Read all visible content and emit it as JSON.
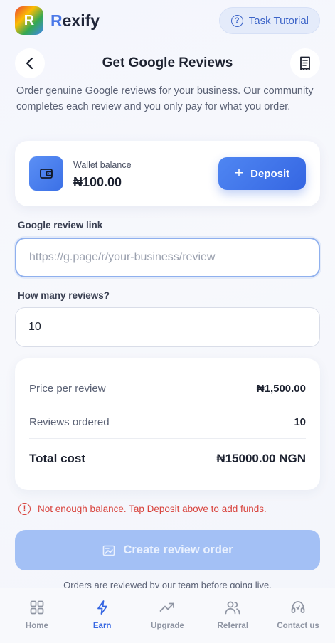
{
  "app": {
    "brand_initial": "R",
    "brand_first": "R",
    "brand_rest": "exify",
    "tutorial_label": "Task Tutorial"
  },
  "header": {
    "title": "Get Google Reviews"
  },
  "description": "Order genuine Google reviews for your business. Our community completes each review and you only pay for what you order.",
  "wallet": {
    "label": "Wallet balance",
    "amount": "₦100.00",
    "deposit_label": "Deposit"
  },
  "form": {
    "link_label": "Google review link",
    "link_placeholder": "https://g.page/r/your-business/review",
    "count_label": "How many reviews?",
    "count_value": "10"
  },
  "summary": {
    "price_label": "Price per review",
    "price_value": "₦1,500.00",
    "ordered_label": "Reviews ordered",
    "ordered_value": "10",
    "total_label": "Total cost",
    "total_value": "₦15000.00 NGN"
  },
  "error": "Not enough balance. Tap Deposit above to add funds.",
  "create_label": "Create review order",
  "footnote": "Orders are reviewed by our team before going live.",
  "nav": {
    "items": [
      "Home",
      "Earn",
      "Upgrade",
      "Referral",
      "Contact us"
    ],
    "active": "Earn"
  },
  "colors": {
    "accent": "#3566e2",
    "error": "#d8433d",
    "disabled_button": "#a3c0f5"
  }
}
